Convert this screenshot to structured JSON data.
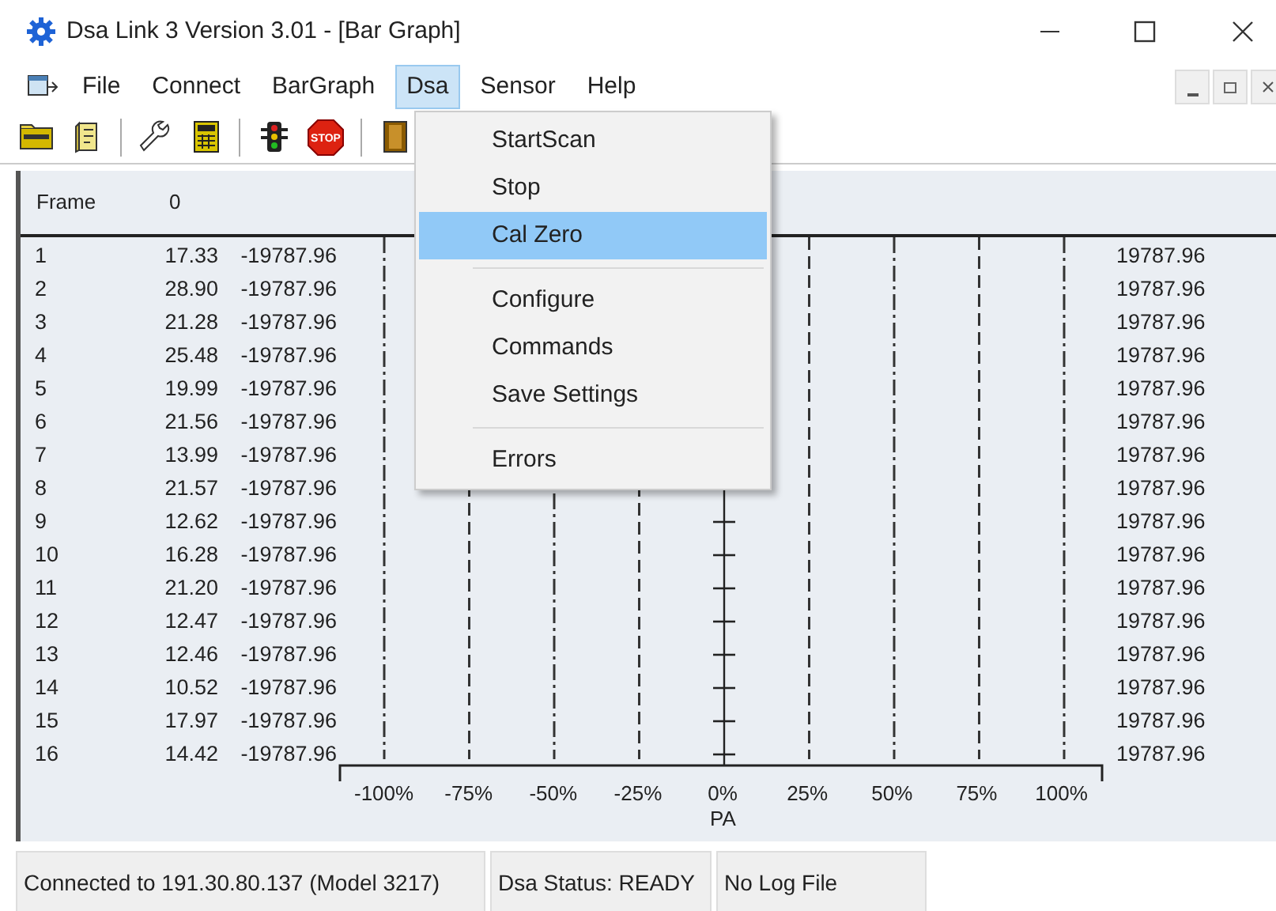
{
  "window": {
    "title": "Dsa Link 3 Version 3.01 - [Bar Graph]"
  },
  "menu_bar": [
    {
      "label": "File",
      "selected": false
    },
    {
      "label": "Connect",
      "selected": false
    },
    {
      "label": "BarGraph",
      "selected": false
    },
    {
      "label": "Dsa",
      "selected": true
    },
    {
      "label": "Sensor",
      "selected": false
    },
    {
      "label": "Help",
      "selected": false
    }
  ],
  "toolbar": [
    {
      "kind": "folder"
    },
    {
      "kind": "note"
    },
    {
      "kind": "separator"
    },
    {
      "kind": "wrench"
    },
    {
      "kind": "calculator"
    },
    {
      "kind": "separator"
    },
    {
      "kind": "traffic-light"
    },
    {
      "kind": "stop",
      "label": "STOP"
    },
    {
      "kind": "separator"
    },
    {
      "kind": "book"
    }
  ],
  "header": {
    "label": "Frame",
    "value": "0"
  },
  "rows": [
    {
      "column_1": "1",
      "column_2": "17.33",
      "column_3": "-19787.96",
      "column_4": "19787.96"
    },
    {
      "column_1": "2",
      "column_2": "28.90",
      "column_3": "-19787.96",
      "column_4": "19787.96"
    },
    {
      "column_1": "3",
      "column_2": "21.28",
      "column_3": "-19787.96",
      "column_4": "19787.96"
    },
    {
      "column_1": "4",
      "column_2": "25.48",
      "column_3": "-19787.96",
      "column_4": "19787.96"
    },
    {
      "column_1": "5",
      "column_2": "19.99",
      "column_3": "-19787.96",
      "column_4": "19787.96"
    },
    {
      "column_1": "6",
      "column_2": "21.56",
      "column_3": "-19787.96",
      "column_4": "19787.96"
    },
    {
      "column_1": "7",
      "column_2": "13.99",
      "column_3": "-19787.96",
      "column_4": "19787.96"
    },
    {
      "column_1": "8",
      "column_2": "21.57",
      "column_3": "-19787.96",
      "column_4": "19787.96"
    },
    {
      "column_1": "9",
      "column_2": "12.62",
      "column_3": "-19787.96",
      "column_4": "19787.96"
    },
    {
      "column_1": "10",
      "column_2": "16.28",
      "column_3": "-19787.96",
      "column_4": "19787.96"
    },
    {
      "column_1": "11",
      "column_2": "21.20",
      "column_3": "-19787.96",
      "column_4": "19787.96"
    },
    {
      "column_1": "12",
      "column_2": "12.47",
      "column_3": "-19787.96",
      "column_4": "19787.96"
    },
    {
      "column_1": "13",
      "column_2": "12.46",
      "column_3": "-19787.96",
      "column_4": "19787.96"
    },
    {
      "column_1": "14",
      "column_2": "10.52",
      "column_3": "-19787.96",
      "column_4": "19787.96"
    },
    {
      "column_1": "15",
      "column_2": "17.97",
      "column_3": "-19787.96",
      "column_4": "19787.96"
    },
    {
      "column_1": "16",
      "column_2": "14.42",
      "column_3": "-19787.96",
      "column_4": "19787.96"
    }
  ],
  "axis": {
    "ticks": [
      "-100%",
      "-75%",
      "-50%",
      "-25%",
      "0%",
      "25%",
      "50%",
      "75%",
      "100%"
    ],
    "label": "PA"
  },
  "dropdown": {
    "items": [
      {
        "kind": "item",
        "label": "StartScan",
        "selected": false
      },
      {
        "kind": "item",
        "label": "Stop",
        "selected": false
      },
      {
        "kind": "item",
        "label": "Cal Zero",
        "selected": true
      },
      {
        "kind": "separator"
      },
      {
        "kind": "item",
        "label": "Configure",
        "selected": false
      },
      {
        "kind": "item",
        "label": "Commands",
        "selected": false
      },
      {
        "kind": "item",
        "label": "Save Settings",
        "selected": false
      },
      {
        "kind": "separator"
      },
      {
        "kind": "item",
        "label": "Errors",
        "selected": false
      }
    ]
  },
  "status_bar": [
    "Connected to 191.30.80.137 (Model 3217)",
    "Dsa Status: READY",
    "No Log File"
  ]
}
